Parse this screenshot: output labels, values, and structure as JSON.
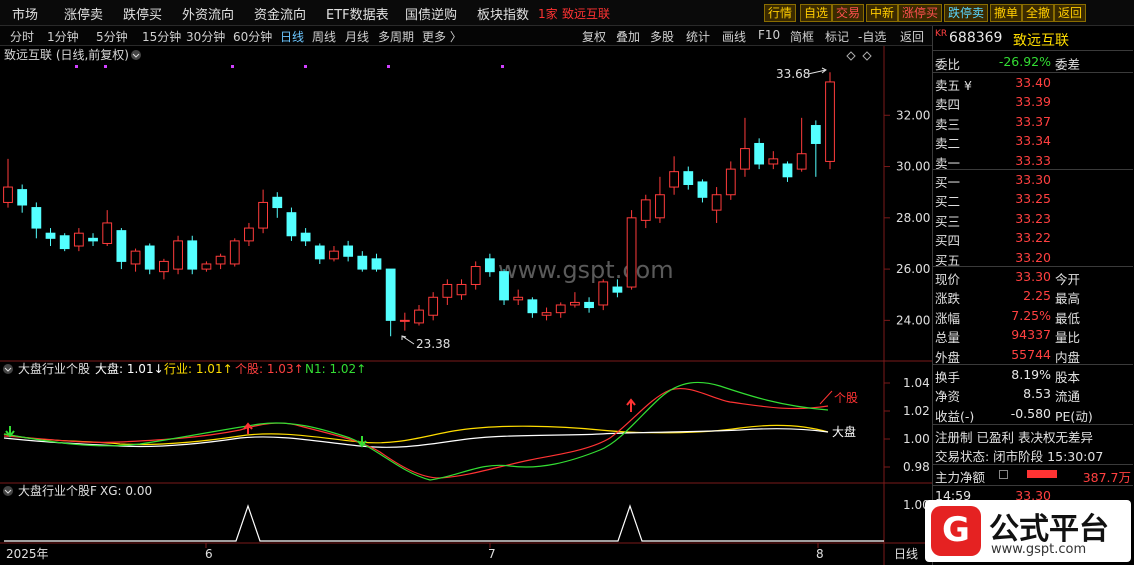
{
  "menu": {
    "items": [
      "市场",
      "涨停卖",
      "跌停买",
      "外资流向",
      "资金流向",
      "ETF数据表",
      "国债逆购",
      "板块指数"
    ],
    "badge": "1家",
    "stock_name": "致远互联",
    "buttons": [
      "行情",
      "自选",
      "交易",
      "中新",
      "涨停买",
      "跌停卖",
      "撤单",
      "全撤",
      "返回"
    ]
  },
  "periods": {
    "items": [
      "分时",
      "1分钟",
      "5分钟",
      "15分钟",
      "30分钟",
      "60分钟",
      "日线",
      "周线",
      "月线",
      "多周期",
      "更多 〉"
    ],
    "active_index": 6,
    "right_items": [
      "复权",
      "叠加",
      "多股",
      "统计",
      "画线",
      "F10",
      "简框",
      "标记",
      "-自选",
      "返回"
    ]
  },
  "chart": {
    "title": "致远互联 (日线,前复权)",
    "high_label": "33.68",
    "low_label": "23.38",
    "watermark": "www.gspt.com",
    "price_ticks": [
      "32.00",
      "30.00",
      "28.00",
      "26.00",
      "24.00"
    ],
    "candles": [
      {
        "o": 28.6,
        "c": 29.2,
        "h": 30.3,
        "l": 28.4
      },
      {
        "o": 29.1,
        "c": 28.5,
        "h": 29.3,
        "l": 28.2
      },
      {
        "o": 28.4,
        "c": 27.6,
        "h": 28.6,
        "l": 27.2
      },
      {
        "o": 27.4,
        "c": 27.2,
        "h": 27.6,
        "l": 26.9
      },
      {
        "o": 27.3,
        "c": 26.8,
        "h": 27.4,
        "l": 26.7
      },
      {
        "o": 26.9,
        "c": 27.4,
        "h": 27.6,
        "l": 26.7
      },
      {
        "o": 27.2,
        "c": 27.1,
        "h": 27.4,
        "l": 26.9
      },
      {
        "o": 27.0,
        "c": 27.8,
        "h": 28.3,
        "l": 26.9
      },
      {
        "o": 27.5,
        "c": 26.3,
        "h": 27.6,
        "l": 26.0
      },
      {
        "o": 26.2,
        "c": 26.7,
        "h": 26.8,
        "l": 25.9
      },
      {
        "o": 26.9,
        "c": 26.0,
        "h": 27.0,
        "l": 25.8
      },
      {
        "o": 25.9,
        "c": 26.3,
        "h": 26.4,
        "l": 25.6
      },
      {
        "o": 26.0,
        "c": 27.1,
        "h": 27.3,
        "l": 25.8
      },
      {
        "o": 27.1,
        "c": 26.0,
        "h": 27.3,
        "l": 25.8
      },
      {
        "o": 26.0,
        "c": 26.2,
        "h": 26.3,
        "l": 25.9
      },
      {
        "o": 26.2,
        "c": 26.5,
        "h": 26.6,
        "l": 26.0
      },
      {
        "o": 26.2,
        "c": 27.1,
        "h": 27.2,
        "l": 26.1
      },
      {
        "o": 27.1,
        "c": 27.6,
        "h": 27.8,
        "l": 26.9
      },
      {
        "o": 27.6,
        "c": 28.6,
        "h": 29.1,
        "l": 27.4
      },
      {
        "o": 28.8,
        "c": 28.4,
        "h": 29.0,
        "l": 28.0
      },
      {
        "o": 28.2,
        "c": 27.3,
        "h": 28.4,
        "l": 27.1
      },
      {
        "o": 27.4,
        "c": 27.1,
        "h": 27.6,
        "l": 26.9
      },
      {
        "o": 26.9,
        "c": 26.4,
        "h": 27.0,
        "l": 26.2
      },
      {
        "o": 26.4,
        "c": 26.7,
        "h": 26.9,
        "l": 26.3
      },
      {
        "o": 26.9,
        "c": 26.5,
        "h": 27.1,
        "l": 26.3
      },
      {
        "o": 26.5,
        "c": 26.0,
        "h": 26.7,
        "l": 25.9
      },
      {
        "o": 26.4,
        "c": 26.0,
        "h": 26.6,
        "l": 25.9
      },
      {
        "o": 26.0,
        "c": 24.0,
        "h": 26.0,
        "l": 23.38
      },
      {
        "o": 24.0,
        "c": 24.0,
        "h": 24.3,
        "l": 23.6
      },
      {
        "o": 23.9,
        "c": 24.4,
        "h": 24.6,
        "l": 23.8
      },
      {
        "o": 24.2,
        "c": 24.9,
        "h": 25.1,
        "l": 24.0
      },
      {
        "o": 24.9,
        "c": 25.4,
        "h": 25.6,
        "l": 24.6
      },
      {
        "o": 25.0,
        "c": 25.4,
        "h": 25.6,
        "l": 24.8
      },
      {
        "o": 25.4,
        "c": 26.1,
        "h": 26.3,
        "l": 25.2
      },
      {
        "o": 26.4,
        "c": 25.9,
        "h": 26.6,
        "l": 25.7
      },
      {
        "o": 25.9,
        "c": 24.8,
        "h": 26.0,
        "l": 24.6
      },
      {
        "o": 24.8,
        "c": 24.9,
        "h": 25.2,
        "l": 24.6
      },
      {
        "o": 24.8,
        "c": 24.3,
        "h": 24.9,
        "l": 24.1
      },
      {
        "o": 24.2,
        "c": 24.3,
        "h": 24.5,
        "l": 24.0
      },
      {
        "o": 24.3,
        "c": 24.6,
        "h": 24.7,
        "l": 24.1
      },
      {
        "o": 24.6,
        "c": 24.7,
        "h": 25.1,
        "l": 24.5
      },
      {
        "o": 24.7,
        "c": 24.5,
        "h": 24.9,
        "l": 24.3
      },
      {
        "o": 24.6,
        "c": 25.5,
        "h": 25.6,
        "l": 24.4
      },
      {
        "o": 25.3,
        "c": 25.1,
        "h": 25.6,
        "l": 24.9
      },
      {
        "o": 25.3,
        "c": 28.0,
        "h": 28.3,
        "l": 25.2
      },
      {
        "o": 27.9,
        "c": 28.7,
        "h": 28.9,
        "l": 27.6
      },
      {
        "o": 28.0,
        "c": 28.9,
        "h": 29.6,
        "l": 27.8
      },
      {
        "o": 29.2,
        "c": 29.8,
        "h": 30.4,
        "l": 28.9
      },
      {
        "o": 29.8,
        "c": 29.3,
        "h": 30.0,
        "l": 29.1
      },
      {
        "o": 29.4,
        "c": 28.8,
        "h": 29.5,
        "l": 28.6
      },
      {
        "o": 28.3,
        "c": 28.9,
        "h": 29.2,
        "l": 27.8
      },
      {
        "o": 28.9,
        "c": 29.9,
        "h": 30.2,
        "l": 28.7
      },
      {
        "o": 29.9,
        "c": 30.7,
        "h": 31.9,
        "l": 29.6
      },
      {
        "o": 30.9,
        "c": 30.1,
        "h": 31.1,
        "l": 29.9
      },
      {
        "o": 30.1,
        "c": 30.3,
        "h": 30.6,
        "l": 29.9
      },
      {
        "o": 30.1,
        "c": 29.6,
        "h": 30.2,
        "l": 29.4
      },
      {
        "o": 29.9,
        "c": 30.5,
        "h": 31.9,
        "l": 29.8
      },
      {
        "o": 31.6,
        "c": 30.9,
        "h": 31.8,
        "l": 29.6
      },
      {
        "o": 30.2,
        "c": 33.3,
        "h": 33.68,
        "l": 29.9
      }
    ],
    "ind1": {
      "name": "大盘行业个股",
      "labels": [
        {
          "text": "大盘: 1.01↓",
          "color": "#ffffff"
        },
        {
          "text": "行业: 1.01↑",
          "color": "#ffdd00"
        },
        {
          "text": "个股: 1.03↑",
          "color": "#ff4040"
        },
        {
          "text": "N1: 1.02↑",
          "color": "#33dd33"
        }
      ],
      "ticks": [
        "1.04",
        "1.02",
        "1.00",
        "0.98"
      ],
      "label_gegu": "个股",
      "label_dapan": "大盘"
    },
    "ind2": {
      "name": "大盘行业个股F",
      "label": "XG: 0.00",
      "tick": "1.00"
    },
    "xaxis": {
      "labels": [
        "2025年",
        "6",
        "7",
        "8"
      ],
      "period": "日线"
    }
  },
  "panel": {
    "code_prefix": "KR",
    "code": "688369",
    "name": "致远互联",
    "weibi_label": "委比",
    "weibi": "-26.92%",
    "weicha_label": "委差",
    "sells": [
      {
        "label": "卖五 ¥",
        "price": "33.40"
      },
      {
        "label": "卖四",
        "price": "33.39"
      },
      {
        "label": "卖三",
        "price": "33.37"
      },
      {
        "label": "卖二",
        "price": "33.34"
      },
      {
        "label": "卖一",
        "price": "33.33"
      }
    ],
    "buys": [
      {
        "label": "买一",
        "price": "33.30"
      },
      {
        "label": "买二",
        "price": "33.25"
      },
      {
        "label": "买三",
        "price": "33.23"
      },
      {
        "label": "买四",
        "price": "33.22"
      },
      {
        "label": "买五",
        "price": "33.20"
      }
    ],
    "stats1": [
      {
        "label": "现价",
        "value": "33.30",
        "right": "今开"
      },
      {
        "label": "涨跌",
        "value": "2.25",
        "right": "最高"
      },
      {
        "label": "涨幅",
        "value": "7.25%",
        "right": "最低"
      },
      {
        "label": "总量",
        "value": "94337",
        "right": "量比"
      },
      {
        "label": "外盘",
        "value": "55744",
        "right": "内盘"
      }
    ],
    "stats2": [
      {
        "label": "换手",
        "value": "8.19%",
        "right": "股本"
      },
      {
        "label": "净资",
        "value": "8.53",
        "right": "流通"
      },
      {
        "label": "收益(-)",
        "value": "-0.580",
        "right": "PE(动)"
      }
    ],
    "tags": "注册制 已盈利 表决权无差异",
    "status": "交易状态: 闭市阶段 15:30:07",
    "main_flow_label": "主力净额",
    "main_flow_value": "387.7万",
    "main_flow_bar": 0.6,
    "tick_time": "14:59",
    "tick_price": "33.30"
  },
  "logo": {
    "text": "公式平台",
    "url": "www.gspt.com",
    "mark": "G"
  },
  "colors": {
    "up": "#ff3c3c",
    "down": "#54ffff",
    "bg": "#000000",
    "grid": "#7a1a1a"
  }
}
